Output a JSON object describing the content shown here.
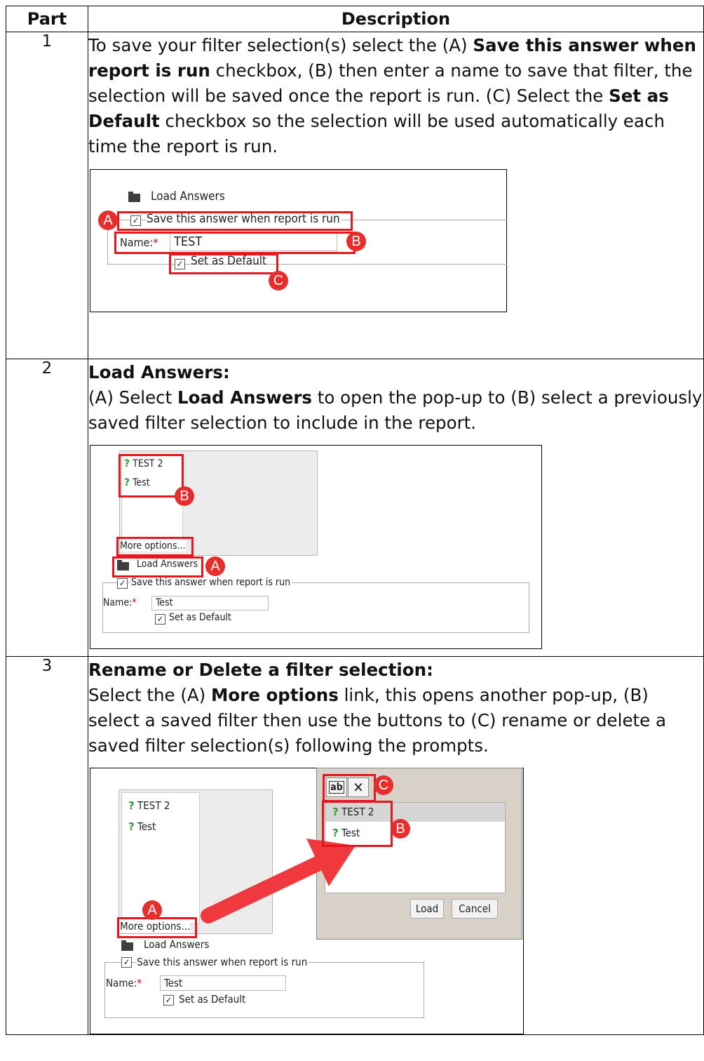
{
  "table": {
    "header_part": "Part",
    "header_description": "Description"
  },
  "row1": {
    "part": "1",
    "text_1": "To save your filter selection(s) select the (A) ",
    "bold_1": "Save this answer when report is run",
    "text_2": " checkbox, (B) then enter a name to save that filter, the selection will be saved once the report is run. (C) Select the ",
    "bold_2": "Set as Default",
    "text_3": " checkbox so the selection will be used automatically each time the report is run.",
    "shot": {
      "load_answers": "Load Answers",
      "save_answer": "Save this answer when report is run",
      "name_label": "Name:",
      "required_mark": "*",
      "name_value": "TEST",
      "set_default": "Set as Default",
      "badge_a": "A",
      "badge_b": "B",
      "badge_c": "C"
    }
  },
  "row2": {
    "part": "2",
    "heading": "Load Answers:",
    "text_1": "(A) Select ",
    "bold_1": "Load Answers",
    "text_2": " to open the pop-up to (B) select a previously saved filter selection to include in the report.",
    "shot": {
      "item_1": "TEST 2",
      "item_2": "Test",
      "more_options": "More options...",
      "load_answers": "Load Answers",
      "save_answer": "Save this answer when report is run",
      "name_label": "Name:",
      "required_mark": "*",
      "name_value": "Test",
      "set_default": "Set as Default",
      "badge_a": "A",
      "badge_b": "B"
    }
  },
  "row3": {
    "part": "3",
    "heading": "Rename or Delete a filter selection:",
    "text_1": "Select the (A) ",
    "bold_1": "More options",
    "text_2": " link, this opens another pop-up, (B) select a saved filter then use the buttons to (C) rename or delete a saved filter selection(s) following the prompts.",
    "shot": {
      "item_1": "TEST 2",
      "item_2": "Test",
      "more_options": "More options...",
      "load_answers": "Load Answers",
      "save_answer": "Save this answer when report is run",
      "name_label": "Name:",
      "required_mark": "*",
      "name_value": "Test",
      "set_default": "Set as Default",
      "popup_item_1": "TEST 2",
      "popup_item_2": "Test",
      "rename_icon": "ab",
      "delete_icon": "✕",
      "load_button": "Load",
      "cancel_button": "Cancel",
      "badge_a": "A",
      "badge_b": "B",
      "badge_c": "C"
    }
  },
  "colors": {
    "annotation_red": "#e8161e",
    "badge_red": "#e82d2d",
    "question_icon_green": "#2e9b2e",
    "popup_bg": "#d8d1c8"
  }
}
